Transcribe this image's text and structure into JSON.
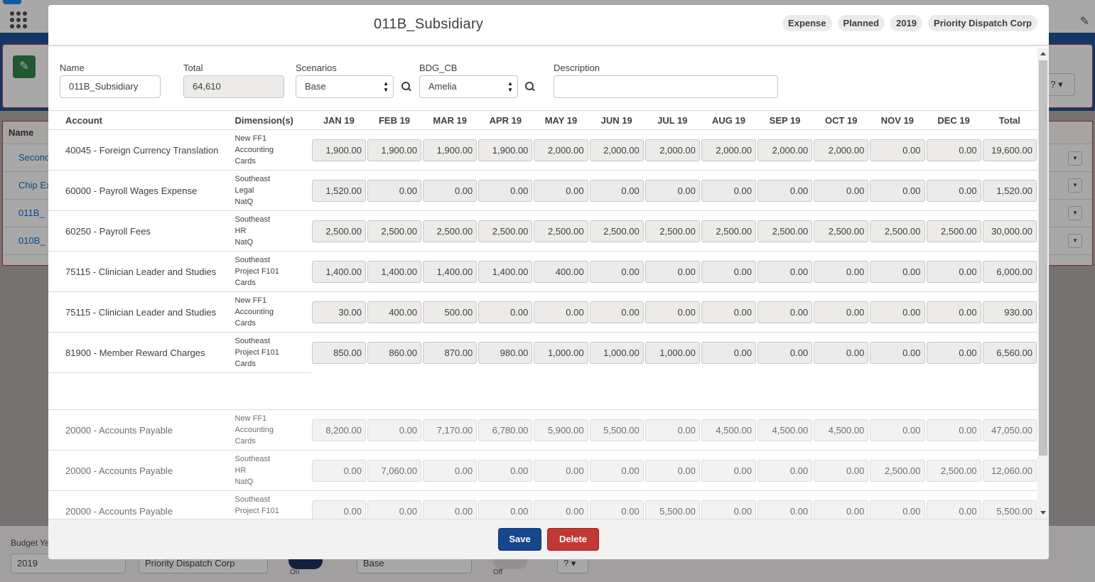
{
  "background": {
    "list_header": "Name",
    "list_rows": [
      "Seconc",
      "Chip Ex",
      "011B_",
      "010B_"
    ],
    "footer_label": "Budget Ye",
    "footer_year": "2019",
    "footer_company": "Priority Dispatch Corp",
    "footer_scenario": "Base",
    "toggle_on_label": "On",
    "toggle_off_label": "Off",
    "help_label": "?"
  },
  "modal": {
    "title": "011B_Subsidiary",
    "pills": [
      "Expense",
      "Planned",
      "2019",
      "Priority Dispatch Corp"
    ],
    "form": {
      "name_label": "Name",
      "name_value": "011B_Subsidiary",
      "total_label": "Total",
      "total_value": "64,610",
      "scenarios_label": "Scenarios",
      "scenarios_value": "Base",
      "bdg_label": "BDG_CB",
      "bdg_value": "Amelia",
      "description_label": "Description",
      "description_value": ""
    },
    "columns": [
      "Account",
      "Dimension(s)",
      "JAN 19",
      "FEB 19",
      "MAR 19",
      "APR 19",
      "MAY 19",
      "JUN 19",
      "JUL 19",
      "AUG 19",
      "SEP 19",
      "OCT 19",
      "NOV 19",
      "DEC 19",
      "Total"
    ],
    "rows": [
      {
        "account": "40045 - Foreign Currency Translation",
        "dims": [
          "New FF1",
          "Accounting",
          "Cards"
        ],
        "values": [
          "1,900.00",
          "1,900.00",
          "1,900.00",
          "1,900.00",
          "2,000.00",
          "2,000.00",
          "2,000.00",
          "2,000.00",
          "2,000.00",
          "2,000.00",
          "0.00",
          "0.00",
          "19,600.00"
        ]
      },
      {
        "account": "60000 - Payroll Wages Expense",
        "dims": [
          "Southeast",
          "Legal",
          "NatQ"
        ],
        "values": [
          "1,520.00",
          "0.00",
          "0.00",
          "0.00",
          "0.00",
          "0.00",
          "0.00",
          "0.00",
          "0.00",
          "0.00",
          "0.00",
          "0.00",
          "1,520.00"
        ]
      },
      {
        "account": "60250 - Payroll Fees",
        "dims": [
          "Southeast",
          "HR",
          "NatQ"
        ],
        "values": [
          "2,500.00",
          "2,500.00",
          "2,500.00",
          "2,500.00",
          "2,500.00",
          "2,500.00",
          "2,500.00",
          "2,500.00",
          "2,500.00",
          "2,500.00",
          "2,500.00",
          "2,500.00",
          "30,000.00"
        ]
      },
      {
        "account": "75115 - Clinician Leader and Studies",
        "dims": [
          "Southeast",
          "Project F101",
          "Cards"
        ],
        "values": [
          "1,400.00",
          "1,400.00",
          "1,400.00",
          "1,400.00",
          "400.00",
          "0.00",
          "0.00",
          "0.00",
          "0.00",
          "0.00",
          "0.00",
          "0.00",
          "6,000.00"
        ]
      },
      {
        "account": "75115 - Clinician Leader and Studies",
        "dims": [
          "New FF1",
          "Accounting",
          "Cards"
        ],
        "values": [
          "30.00",
          "400.00",
          "500.00",
          "0.00",
          "0.00",
          "0.00",
          "0.00",
          "0.00",
          "0.00",
          "0.00",
          "0.00",
          "0.00",
          "930.00"
        ]
      },
      {
        "account": "81900 - Member Reward Charges",
        "dims": [
          "Southeast",
          "Project F101",
          "Cards"
        ],
        "values": [
          "850.00",
          "860.00",
          "870.00",
          "980.00",
          "1,000.00",
          "1,000.00",
          "1,000.00",
          "0.00",
          "0.00",
          "0.00",
          "0.00",
          "0.00",
          "6,560.00"
        ]
      }
    ],
    "offset_rows": [
      {
        "account": "20000 - Accounts Payable",
        "dims": [
          "New FF1",
          "Accounting",
          "Cards"
        ],
        "values": [
          "8,200.00",
          "0.00",
          "7,170.00",
          "6,780.00",
          "5,900.00",
          "5,500.00",
          "0.00",
          "4,500.00",
          "4,500.00",
          "4,500.00",
          "0.00",
          "0.00",
          "47,050.00"
        ]
      },
      {
        "account": "20000 - Accounts Payable",
        "dims": [
          "Southeast",
          "HR",
          "NatQ"
        ],
        "values": [
          "0.00",
          "7,060.00",
          "0.00",
          "0.00",
          "0.00",
          "0.00",
          "0.00",
          "0.00",
          "0.00",
          "0.00",
          "2,500.00",
          "2,500.00",
          "12,060.00"
        ]
      },
      {
        "account": "20000 - Accounts Payable",
        "dims": [
          "Southeast",
          "Project F101",
          "Cards"
        ],
        "values": [
          "0.00",
          "0.00",
          "0.00",
          "0.00",
          "0.00",
          "0.00",
          "5,500.00",
          "0.00",
          "0.00",
          "0.00",
          "0.00",
          "0.00",
          "5,500.00"
        ]
      }
    ],
    "save_label": "Save",
    "delete_label": "Delete"
  }
}
